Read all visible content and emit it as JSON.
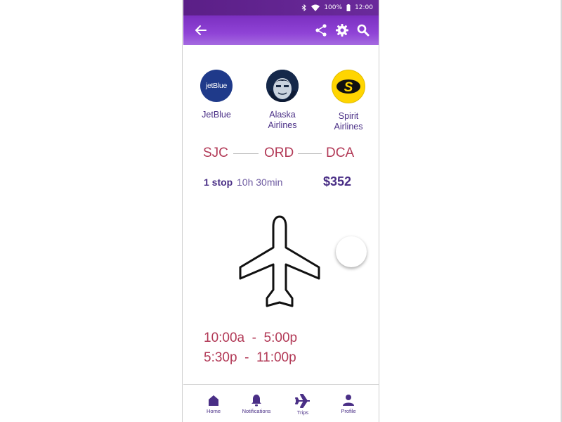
{
  "status_bar": {
    "battery": "100%",
    "time": "12:00",
    "icons": [
      "bluetooth-icon",
      "wifi-icon",
      "battery-icon"
    ]
  },
  "app_bar": {
    "back_icon": "arrow-left-icon",
    "actions": [
      "share-icon",
      "gear-icon",
      "search-icon"
    ]
  },
  "airlines": [
    {
      "name": "JetBlue",
      "logo_text": "jetBlue"
    },
    {
      "name": "Alaska\nAirlines",
      "logo_text": ""
    },
    {
      "name": "Spirit\nAirlines",
      "logo_text": "S"
    }
  ],
  "route": {
    "origin": "SJC",
    "stop": "ORD",
    "destination": "DCA"
  },
  "summary": {
    "stops": "1 stop",
    "duration": "10h 30min",
    "price": "$352"
  },
  "times": [
    "10:00a  -  5:00p",
    "5:30p  -  11:00p"
  ],
  "bottom_nav": [
    {
      "label": "Home",
      "icon": "home-icon"
    },
    {
      "label": "Notifications",
      "icon": "bell-icon"
    },
    {
      "label": "Trips",
      "icon": "plane-icon"
    },
    {
      "label": "Profile",
      "icon": "person-icon"
    }
  ],
  "colors": {
    "primary": "#6a2a9b",
    "accent_red": "#b23a57",
    "text_purple": "#4a2f86"
  }
}
